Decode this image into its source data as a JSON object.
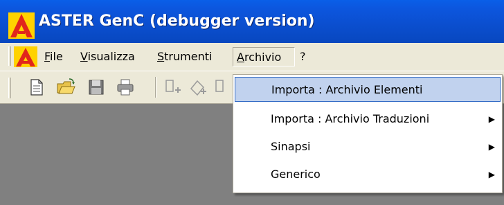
{
  "window": {
    "title": "ASTER GenC (debugger version)"
  },
  "menubar": {
    "items": [
      {
        "mnemonic": "F",
        "rest": "ile"
      },
      {
        "mnemonic": "V",
        "rest": "isualizza"
      },
      {
        "mnemonic": "S",
        "rest": "trumenti"
      },
      {
        "mnemonic": "A",
        "rest": "rchivio"
      },
      {
        "mnemonic": "",
        "rest": "?"
      }
    ],
    "active_item": "Archivio"
  },
  "toolbar": {
    "icons": [
      "new-document-icon",
      "open-folder-icon",
      "save-icon",
      "print-icon",
      "add-element-icon",
      "edit-element-icon",
      "remove-element-icon"
    ]
  },
  "archivio_menu": {
    "items": [
      {
        "label": "Importa : Archivio Elementi",
        "submenu": false,
        "highlighted": true
      },
      {
        "label": "Importa : Archivio Traduzioni",
        "submenu": true,
        "highlighted": false
      },
      {
        "label": "Sinapsi",
        "submenu": true,
        "highlighted": false
      },
      {
        "label": "Generico",
        "submenu": true,
        "highlighted": false
      }
    ]
  },
  "colors": {
    "titlebar": "#0b4fd0",
    "menu_face": "#ece9d8",
    "workspace": "#808080",
    "highlight_bg": "#c1d2ee",
    "highlight_border": "#316ac5",
    "logo_red": "#e1261c",
    "logo_yellow": "#ffd200"
  }
}
